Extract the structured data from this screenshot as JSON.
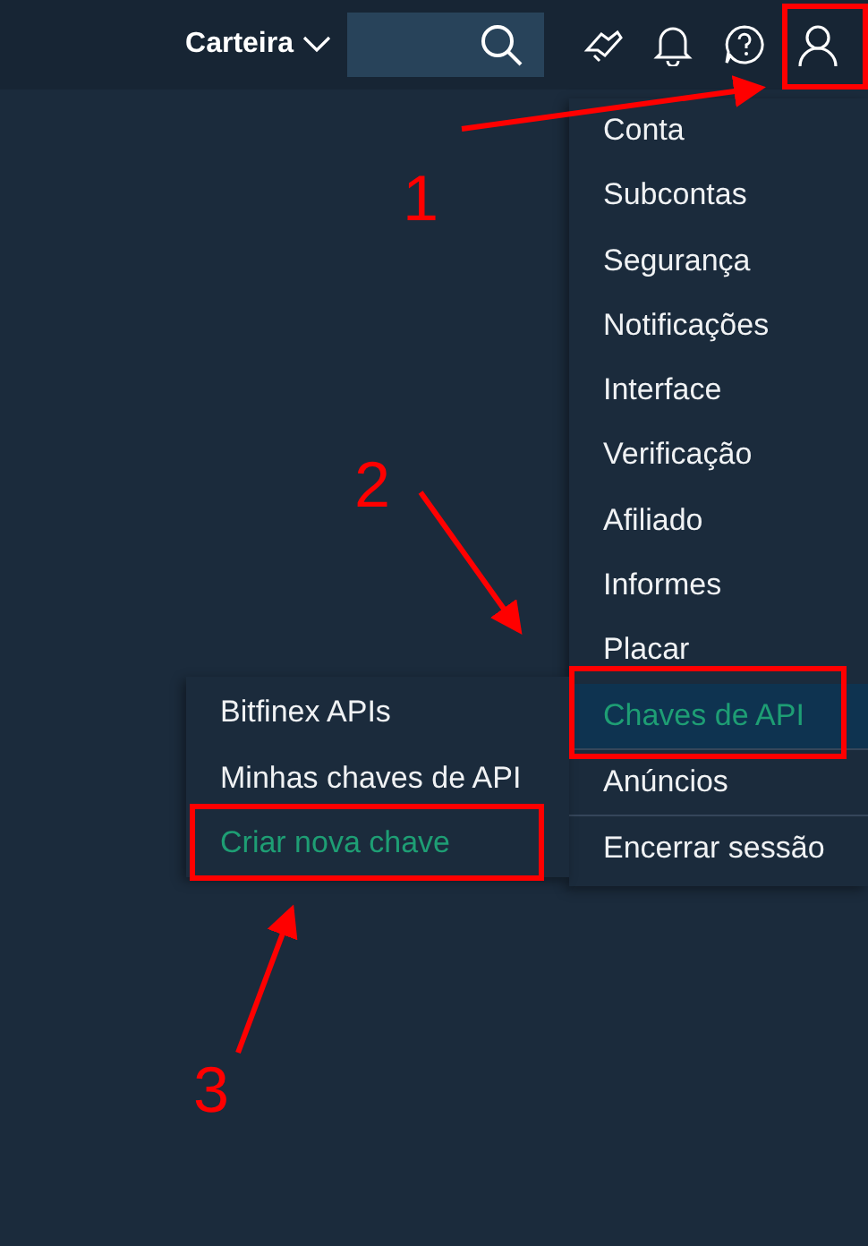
{
  "header": {
    "wallet_menu": "Carteira"
  },
  "account_menu": [
    {
      "label": "Conta",
      "selected": false,
      "separated": false
    },
    {
      "label": "Subcontas",
      "selected": false,
      "separated": false
    },
    {
      "label": "Segurança",
      "selected": false,
      "separated": false
    },
    {
      "label": "Notificações",
      "selected": false,
      "separated": false
    },
    {
      "label": "Interface",
      "selected": false,
      "separated": false
    },
    {
      "label": "Verificação",
      "selected": false,
      "separated": false
    },
    {
      "label": "Afiliado",
      "selected": false,
      "separated": false
    },
    {
      "label": "Informes",
      "selected": false,
      "separated": false
    },
    {
      "label": "Placar",
      "selected": false,
      "separated": false
    },
    {
      "label": "Chaves de API",
      "selected": true,
      "separated": false
    },
    {
      "label": "Anúncios",
      "selected": false,
      "separated": true
    },
    {
      "label": "Encerrar sessão",
      "selected": false,
      "separated": true
    }
  ],
  "api_submenu": [
    {
      "label": "Bitfinex APIs",
      "selected": false
    },
    {
      "label": "Minhas chaves de API",
      "selected": false
    },
    {
      "label": "Criar nova chave",
      "selected": true
    }
  ],
  "annotations": [
    {
      "label": "1"
    },
    {
      "label": "2"
    },
    {
      "label": "3"
    }
  ]
}
